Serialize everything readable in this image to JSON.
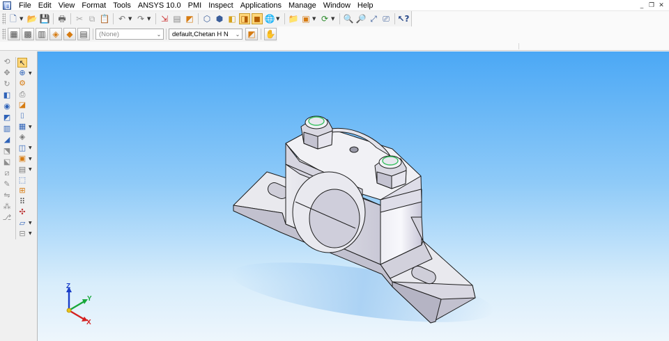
{
  "menubar": {
    "items": [
      "File",
      "Edit",
      "View",
      "Format",
      "Tools",
      "ANSYS 10.0",
      "PMI",
      "Inspect",
      "Applications",
      "Manage",
      "Window",
      "Help"
    ],
    "window_controls": [
      "_",
      "❐",
      "✕"
    ]
  },
  "toolbar2": {
    "style_select": "(None)",
    "layer_select": "default,Chetan H N"
  },
  "viewport": {
    "model": "pillow-block-bearing",
    "triad": {
      "x_label": "X",
      "y_label": "Y",
      "z_label": "Z"
    },
    "colors": {
      "background_top": "#4ba8f5",
      "background_bottom": "#eef6fc",
      "part": "#e7e7ee",
      "accent": "#38c060"
    }
  }
}
